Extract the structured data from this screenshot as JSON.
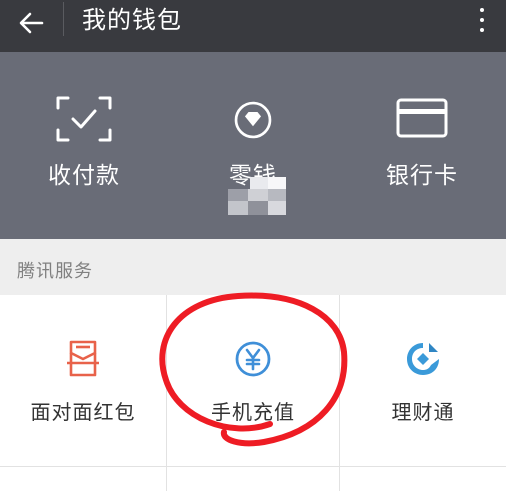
{
  "header": {
    "title": "我的钱包"
  },
  "panel": {
    "items": [
      {
        "label": "收付款",
        "icon": "scan-pay-icon"
      },
      {
        "label": "零钱",
        "icon": "diamond-icon"
      },
      {
        "label": "银行卡",
        "icon": "bank-card-icon"
      }
    ]
  },
  "section": {
    "title": "腾讯服务"
  },
  "services": [
    {
      "label": "面对面红包",
      "icon": "red-packet-icon",
      "color": "#e8624a"
    },
    {
      "label": "手机充值",
      "icon": "yuan-icon",
      "color": "#3f8fd8"
    },
    {
      "label": "理财通",
      "icon": "wealth-icon",
      "color": "#3a9ad9"
    }
  ],
  "colors": {
    "header_bg": "#393a3f",
    "panel_bg": "#696c77",
    "annotation": "#ee1c24"
  }
}
